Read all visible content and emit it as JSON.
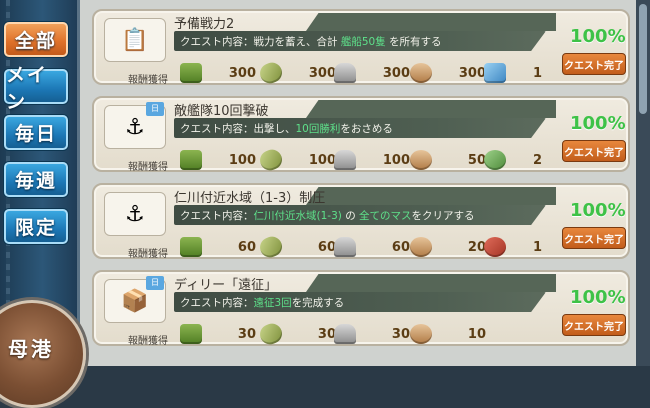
{
  "sidebar": {
    "tabs": [
      {
        "label": "全部",
        "active": true
      },
      {
        "label": "メイン",
        "active": false
      },
      {
        "label": "毎日",
        "active": false
      },
      {
        "label": "毎週",
        "active": false
      },
      {
        "label": "限定",
        "active": false
      }
    ],
    "home_label": "母港"
  },
  "reward_label": "報酬獲得",
  "quests": [
    {
      "title": "予備戦力2",
      "desc_prefix": "クエスト内容：戦力を蓄え、合計",
      "desc_highlight": "艦船50隻",
      "desc_suffix": "を所有する",
      "percent": "100%",
      "complete_label": "クエスト完了",
      "badge": "",
      "rewards": [
        {
          "type": "fuel",
          "amount": "300"
        },
        {
          "type": "ammo",
          "amount": "300"
        },
        {
          "type": "steel",
          "amount": "300"
        },
        {
          "type": "baux",
          "amount": "300"
        },
        {
          "type": "special",
          "amount": "1"
        }
      ]
    },
    {
      "title": "敵艦隊10回撃破",
      "desc_prefix": "クエスト内容：出撃し、",
      "desc_highlight": "10回勝利",
      "desc_suffix": "をおさめる",
      "percent": "100%",
      "complete_label": "クエスト完了",
      "badge": "日",
      "rewards": [
        {
          "type": "fuel",
          "amount": "100"
        },
        {
          "type": "ammo",
          "amount": "100"
        },
        {
          "type": "steel",
          "amount": "100"
        },
        {
          "type": "baux",
          "amount": "50"
        },
        {
          "type": "special green",
          "amount": "2"
        }
      ]
    },
    {
      "title": "仁川付近水域（1-3）制圧",
      "desc_prefix": "クエスト内容：",
      "desc_highlight": "仁川付近水域(1-3)",
      "desc_mid": "の",
      "desc_highlight2": "全てのマス",
      "desc_suffix": "をクリアする",
      "percent": "100%",
      "complete_label": "クエスト完了",
      "badge": "",
      "rewards": [
        {
          "type": "fuel",
          "amount": "60"
        },
        {
          "type": "ammo",
          "amount": "60"
        },
        {
          "type": "steel",
          "amount": "60"
        },
        {
          "type": "baux",
          "amount": "20"
        },
        {
          "type": "special red",
          "amount": "1"
        }
      ]
    },
    {
      "title": "ディリー「遠征」",
      "desc_prefix": "クエスト内容：",
      "desc_highlight": "遠征3回",
      "desc_suffix": "を完成する",
      "percent": "100%",
      "complete_label": "クエスト完了",
      "badge": "日",
      "rewards": [
        {
          "type": "fuel",
          "amount": "30"
        },
        {
          "type": "ammo",
          "amount": "30"
        },
        {
          "type": "steel",
          "amount": "30"
        },
        {
          "type": "baux",
          "amount": "10"
        }
      ]
    }
  ]
}
